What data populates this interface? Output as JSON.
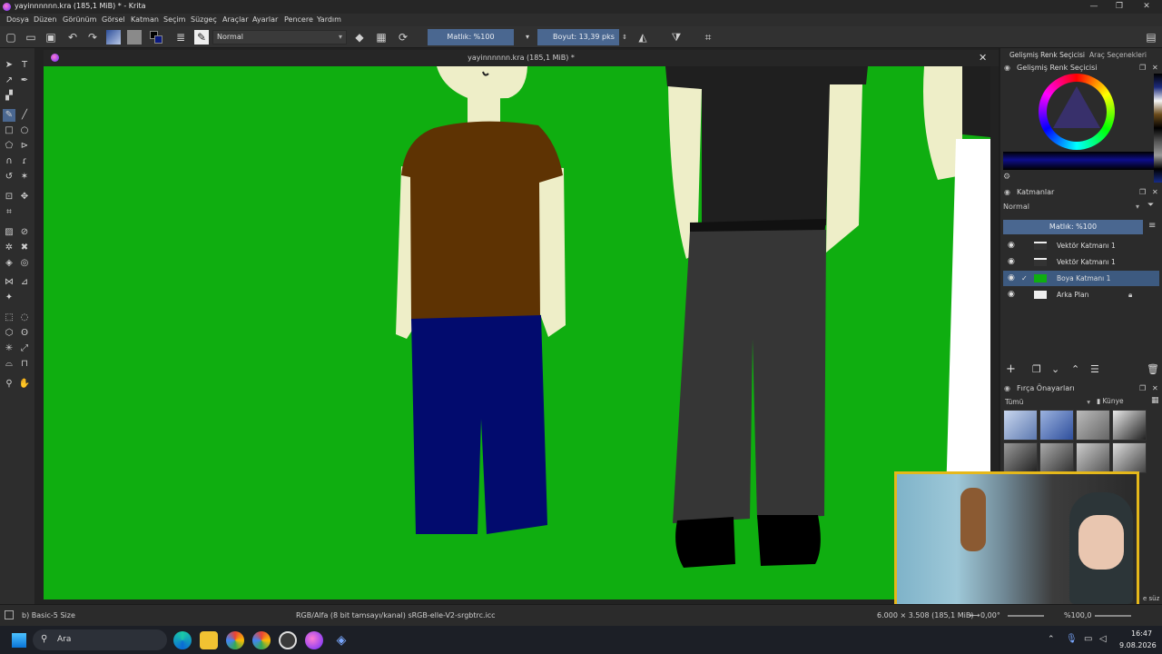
{
  "window": {
    "title": "yayinnnnnn.kra (185,1 MiB) * - Krita",
    "minimize": "—",
    "maximize": "❐",
    "close": "✕"
  },
  "menu": [
    "Dosya",
    "Düzen",
    "Görünüm",
    "Görsel",
    "Katman",
    "Seçim",
    "Süzgeç",
    "Araçlar",
    "Ayarlar",
    "Pencere",
    "Yardım"
  ],
  "toolbar": {
    "blend_mode": "Normal",
    "opacity": "Matlık: %100",
    "size": "Boyut: 13,39 pks"
  },
  "document": {
    "tab_title": "yayinnnnnn.kra (185,1 MiB) *",
    "close": "✕"
  },
  "right_panel": {
    "tabs": [
      "Gelişmiş Renk Seçicisi",
      "Araç Seçenekleri"
    ],
    "color_selector_title": "Gelişmiş Renk Seçicisi",
    "layers_title": "Katmanlar",
    "layers_blend": "Normal",
    "layers_opacity": "Matlık: %100",
    "layers": [
      {
        "name": "Vektör Katmanı 1",
        "selected": false
      },
      {
        "name": "Vektör Katmanı 1",
        "selected": false
      },
      {
        "name": "Boya Katmanı 1",
        "selected": true
      },
      {
        "name": "Arka Plan",
        "selected": false
      }
    ],
    "brush_presets_title": "Fırça Önayarları",
    "brush_filter": "Tümü",
    "brush_tag": "Künye",
    "filter_suffix": "e süz"
  },
  "status": {
    "brush": "b) Basic-5 Size",
    "colorspace": "RGB/Alfa (8 bit tamsayı/kanal) sRGB-elle-V2-srgbtrc.icc",
    "dimensions": "6.000 × 3.508 (185,1 MiB)",
    "rotation": "0,00°",
    "zoom": "%100,0"
  },
  "taskbar": {
    "search": "Ara",
    "time": "16:47",
    "date": "9.08.2026"
  },
  "colors": {
    "canvas_bg": "#0fae10",
    "selected_layer": "#3d5a80",
    "webcam_border": "#e5b81a"
  }
}
